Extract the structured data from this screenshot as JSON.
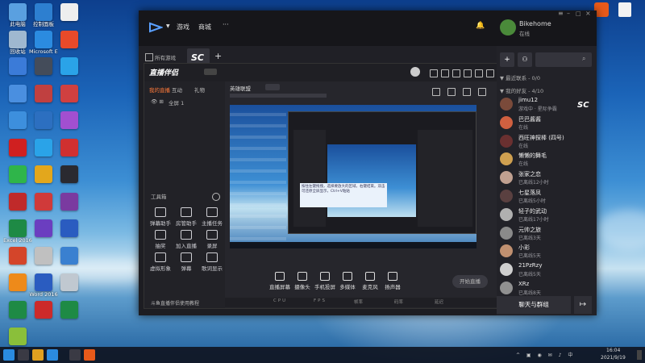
{
  "desktop_icons": [
    {
      "label": "此电脑",
      "color": "#5aa0e0"
    },
    {
      "label": "控制面板",
      "color": "#2d7fd0"
    },
    {
      "label": "",
      "color": "#eeeeee"
    },
    {
      "label": "回收站",
      "color": "#9fb8d0"
    },
    {
      "label": "Microsoft Edge",
      "color": "#2b8be0"
    },
    {
      "label": "",
      "color": "#e84a2a"
    },
    {
      "label": "",
      "color": "#3b7bd8"
    },
    {
      "label": "",
      "color": "#444c5a"
    },
    {
      "label": "",
      "color": "#2aa3e8"
    },
    {
      "label": "",
      "color": "#4a8fe0"
    },
    {
      "label": "",
      "color": "#c04040"
    },
    {
      "label": "",
      "color": "#d04040"
    },
    {
      "label": "",
      "color": "#3d8fdd"
    },
    {
      "label": "",
      "color": "#2c6fc0"
    },
    {
      "label": "",
      "color": "#a24fd0"
    },
    {
      "label": "",
      "color": "#d02020"
    },
    {
      "label": "",
      "color": "#2aa3e8"
    },
    {
      "label": "",
      "color": "#d03030"
    },
    {
      "label": "",
      "color": "#2fb54a"
    },
    {
      "label": "",
      "color": "#e3a71c"
    },
    {
      "label": "",
      "color": "#2a2a30"
    },
    {
      "label": "",
      "color": "#c02a2a"
    },
    {
      "label": "",
      "color": "#d03a3a"
    },
    {
      "label": "",
      "color": "#7a3aa0"
    },
    {
      "label": "Excel 2016",
      "color": "#1e8a45"
    },
    {
      "label": "",
      "color": "#6b3ec0"
    },
    {
      "label": "",
      "color": "#2a5cc0"
    },
    {
      "label": "",
      "color": "#d4452a"
    },
    {
      "label": "",
      "color": "#c0c0c0"
    },
    {
      "label": "",
      "color": "#3a80d0"
    },
    {
      "label": "",
      "color": "#ee8a1a"
    },
    {
      "label": "Word 2016",
      "color": "#2a5cc0"
    },
    {
      "label": "",
      "color": "#c0c8d0"
    },
    {
      "label": "",
      "color": "#1e8a45"
    },
    {
      "label": "",
      "color": "#cc2a2a"
    },
    {
      "label": "",
      "color": "#1e8a45"
    },
    {
      "label": "",
      "color": "#8abf3a"
    }
  ],
  "topbar": {
    "nav_game": "游戏",
    "nav_mall": "商城",
    "nav_more": "···",
    "username": "Bikehome",
    "status": "在线"
  },
  "tabs": {
    "all_games": "所有游戏",
    "active_tab": "SC",
    "add": "+"
  },
  "live_app": {
    "title": "直播伴侣",
    "tabs": [
      "我的直播",
      "互动",
      "礼物"
    ],
    "scene_item": "全屏 1",
    "tools_header": "工具箱",
    "tools": [
      "弹幕助手",
      "房管助手",
      "主播任务",
      "抽奖",
      "加入直播",
      "录屏",
      "虚拟形象",
      "弹幕",
      "歌词显示"
    ],
    "footer_link": "斗鱼直播伴侣使用教程",
    "room_title": "英雄联盟",
    "bottom_controls": [
      "直播屏幕",
      "摄像头",
      "手机投屏",
      "多媒体",
      "麦克风",
      "扬声器"
    ],
    "start_button": "开始直播",
    "status_bar": [
      "CPU",
      "FPS",
      "帧率",
      "码率",
      "延迟"
    ]
  },
  "popup_text": "按住左键拖拽，选择要放大的区域，右键结束。双击可还原全屏显示，Ctrl+V粘贴",
  "sidebar": {
    "group_recent": "▼ 最近联系 - 0/0",
    "group_friends": "▼ 我的好友 - 4/10",
    "friends": [
      {
        "name": "jimu12",
        "status": "游戏中 · 星际争霸",
        "color": "#7a4a3a"
      },
      {
        "name": "巴巴酱酱",
        "status": "在线",
        "color": "#d06040"
      },
      {
        "name": "西旺神探棒 (四号)",
        "status": "在线",
        "color": "#6a3030"
      },
      {
        "name": "懒懒的舞毛",
        "status": "在线",
        "color": "#cfa050"
      },
      {
        "name": "张家之恋",
        "status": "已离线12小时",
        "color": "#c0a090"
      },
      {
        "name": "七星落凤",
        "status": "已离线5小时",
        "color": "#5a4040"
      },
      {
        "name": "轻子的武动",
        "status": "已离线17小时",
        "color": "#b0b0b0"
      },
      {
        "name": "元帅之旅",
        "status": "已离线3天",
        "color": "#8a8a8a"
      },
      {
        "name": "小彩",
        "status": "已离线5天",
        "color": "#c09070"
      },
      {
        "name": "21PzRzy",
        "status": "已离线5天",
        "color": "#cfcfcf"
      },
      {
        "name": "XRz",
        "status": "已离线8天",
        "color": "#909090"
      }
    ],
    "chat_button": "聊天与群组"
  },
  "taskbar": {
    "time": "16:04",
    "date": "2021/9/19"
  }
}
